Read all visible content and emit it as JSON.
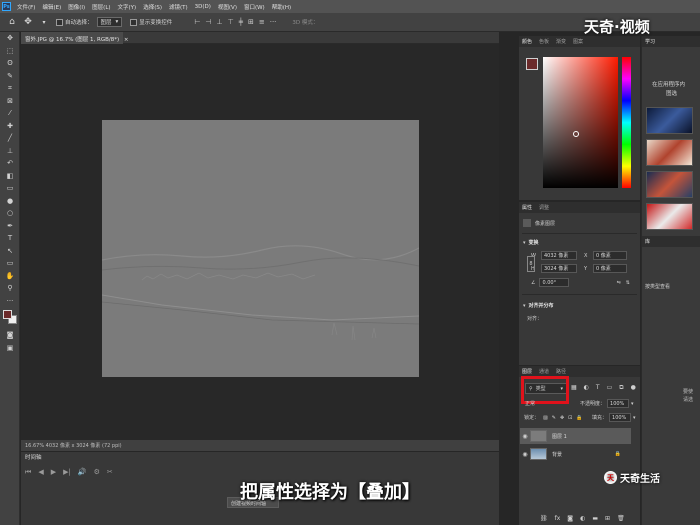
{
  "menubar": {
    "logo": "Ps",
    "items": [
      "文件(F)",
      "编辑(E)",
      "图像(I)",
      "图层(L)",
      "文字(Y)",
      "选择(S)",
      "滤镜(T)",
      "3D(D)",
      "视图(V)",
      "窗口(W)",
      "帮助(H)"
    ]
  },
  "options": {
    "auto_select_label": "自动选择：",
    "auto_select_value": "图层",
    "show_transform_label": "显示变换控件",
    "mode_3d": "3D 模式："
  },
  "document": {
    "tab_title": "窗外.JPG @ 16.7% (图层 1, RGB/8*)",
    "tab_close": "×",
    "status": "16.67%    4032 像素 x 3024 像素 (72 ppi)"
  },
  "timeline": {
    "tab": "时间轴",
    "create_button": "创建视频时间轴",
    "controls": [
      "⏮",
      "◀",
      "▶",
      "▶|",
      "🔊",
      "⚙",
      "✂"
    ]
  },
  "caption": "把属性选择为【叠加】",
  "color_panel": {
    "tabs": [
      "颜色",
      "色板",
      "渐变",
      "图案"
    ],
    "fg_color": "#6b2a2a"
  },
  "properties_panel": {
    "tabs": [
      "属性",
      "调整"
    ],
    "layer_type": "像素图层",
    "transform_title": "变换",
    "w_label": "W",
    "w_value": "4032 像素",
    "h_label": "H",
    "h_value": "3024 像素",
    "x_label": "X",
    "x_value": "0 像素",
    "y_label": "Y",
    "y_value": "0 像素",
    "angle_value": "0.00°",
    "align_title": "对齐并分布",
    "align_label": "对齐："
  },
  "layers_panel": {
    "tabs": [
      "图层",
      "通道",
      "路径"
    ],
    "filter_value": "类型",
    "blend_mode": "正常",
    "opacity_label": "不透明度：",
    "opacity_value": "100%",
    "lock_label": "锁定：",
    "fill_label": "填充：",
    "fill_value": "100%",
    "layers": [
      {
        "name": "图层 1",
        "selected": true
      },
      {
        "name": "背景",
        "selected": false
      }
    ]
  },
  "learn_panel": {
    "tab": "学习",
    "text1": "在应用程序内",
    "text2": "图选",
    "section": "库",
    "search_placeholder": "按类型查看",
    "foot_text1": "要使",
    "foot_text2": "请选"
  },
  "watermarks": {
    "top": "天奇·视频",
    "bottom": "天奇生活",
    "bottom_logo": "天"
  },
  "colors": {
    "accent_red": "#e0121b"
  }
}
